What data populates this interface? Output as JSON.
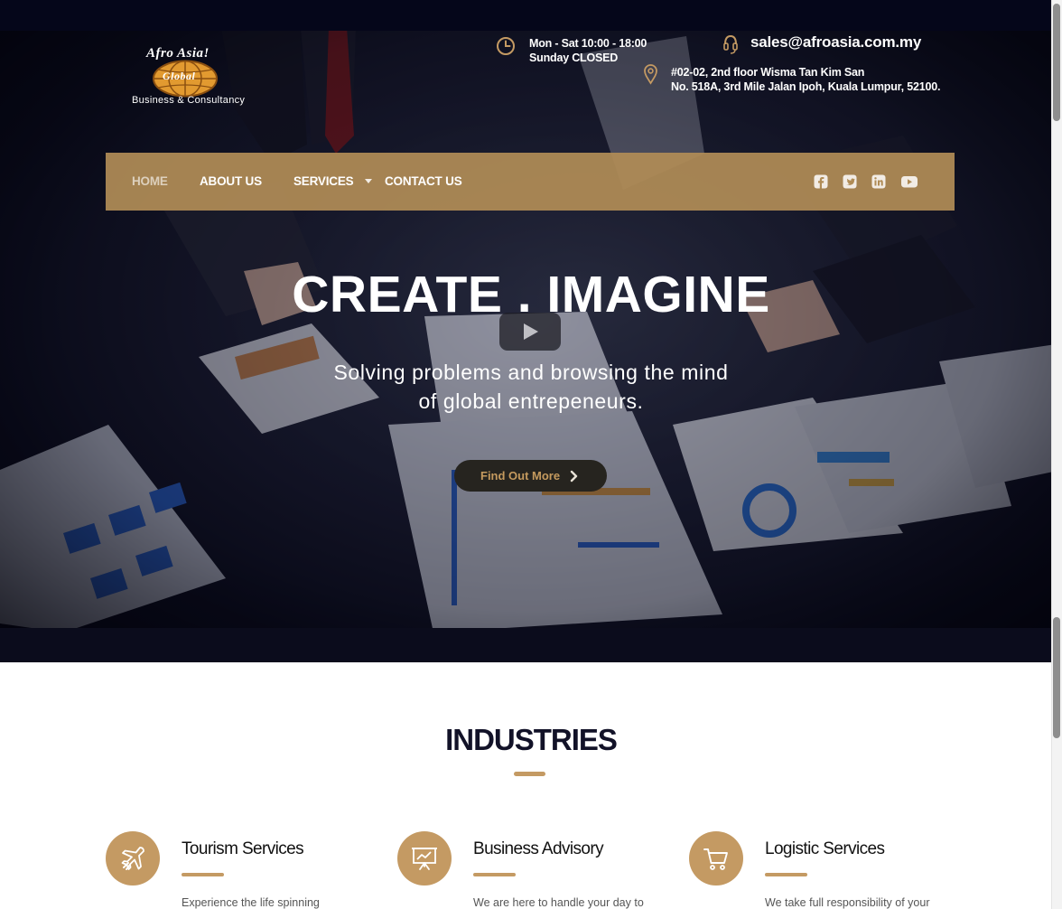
{
  "logo": {
    "line1": "Afro Asia!",
    "line2": "Global",
    "tagline": "Business & Consultancy"
  },
  "contact": {
    "hours_line1": "Mon - Sat 10:00 - 18:00",
    "hours_line2": "Sunday CLOSED",
    "email": "sales@afroasia.com.my",
    "address_line1": "#02-02, 2nd floor Wisma Tan Kim San",
    "address_line2": "No. 518A, 3rd Mile Jalan Ipoh, Kuala Lumpur, 52100."
  },
  "nav": {
    "home": "HOME",
    "about": "ABOUT US",
    "services": "SERVICES",
    "contact": "CONTACT US"
  },
  "social": [
    "facebook-icon",
    "twitter-icon",
    "linkedin-icon",
    "youtube-icon"
  ],
  "hero": {
    "title": "CREATE . IMAGINE",
    "subtitle_line1": "Solving problems and browsing the mind",
    "subtitle_line2": "of global entrepeneurs.",
    "cta": "Find Out More"
  },
  "industries": {
    "title": "INDUSTRIES",
    "cards": [
      {
        "icon": "plane-icon",
        "title": "Tourism Services",
        "desc": "Experience the life spinning"
      },
      {
        "icon": "presentation-chart-icon",
        "title": "Business Advisory",
        "desc": "We are here to handle your day to"
      },
      {
        "icon": "shopping-cart-icon",
        "title": "Logistic Services",
        "desc": "We take full responsibility of your"
      }
    ]
  },
  "colors": {
    "accent": "#c49a63",
    "nav_bg": "#b08c56",
    "dark": "#121228"
  }
}
